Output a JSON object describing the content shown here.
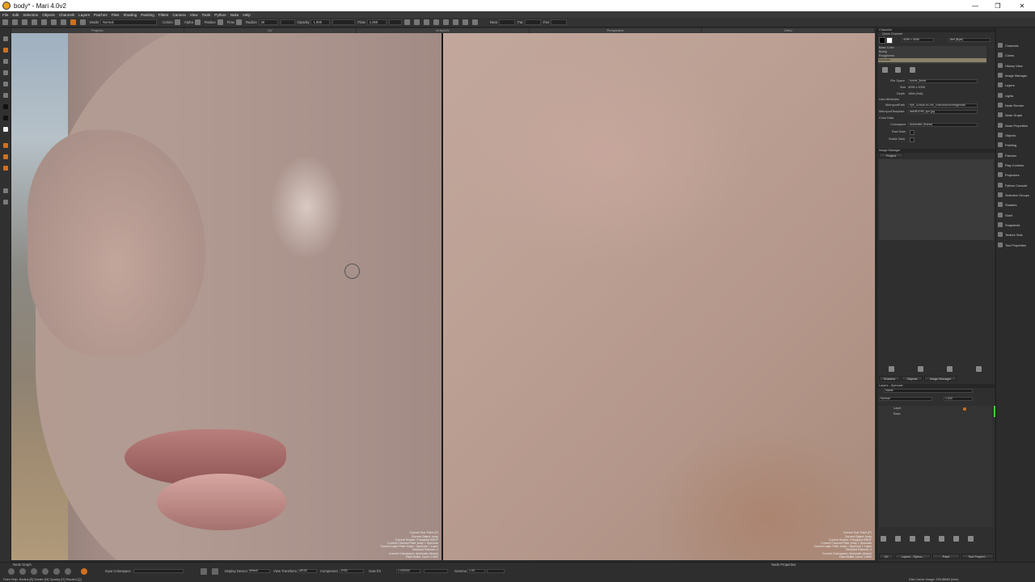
{
  "window": {
    "title": "body* - Mari 4.0v2",
    "minimize": "—",
    "maximize": "❐",
    "close": "✕"
  },
  "menu": [
    "File",
    "Edit",
    "Selection",
    "Objects",
    "Channels",
    "Layers",
    "Patches",
    "Files",
    "Shading",
    "Painting",
    "Filters",
    "Camera",
    "View",
    "Tools",
    "Python",
    "Nuke",
    "Help"
  ],
  "toolbar": {
    "mode_label": "Mode",
    "mode_value": "Normal",
    "colors_label": "Colors",
    "alpha_label": "Alpha",
    "radius_label": "Radius",
    "flow_label": "Flow",
    "radius2_label": "Radius",
    "radius2_value": "30",
    "opacity_label": "Opacity",
    "opacity_value": "1.000",
    "flow2_label": "Flow",
    "flow2_value": "1.000",
    "near_label": "Near",
    "far_label": "Far",
    "fov_label": "Fov"
  },
  "viewport_tabs": [
    "Projects",
    "UV",
    "Ortho/UV",
    "Perspective",
    "Ortho"
  ],
  "hud_left": [
    "Current Tool: Paint (P)",
    "Current Object: body",
    "Current Shader: Principled BRDF",
    "Current Channel Path: body > Specular",
    "Current Layer Path: body > Specular > Layer",
    "Selected Patches: 0",
    "Current Colorspace: Automatic (linear)",
    "Paint Buffer Zoom: 136%"
  ],
  "hud_right": [
    "Current Tool: Paint (P)",
    "Current Object: body",
    "Current Shader: Principled BRDF",
    "Current Channel Path: body > Specular",
    "Current Layer Path: body > Specular > Layer",
    "Selected Patches: 0",
    "Current Colorspace: Automatic (linear)",
    "Paint Buffer Zoom: 136%"
  ],
  "channels": {
    "header": "Channels",
    "quick_label": "Quick Channel",
    "size_value": "4096 x 4096",
    "depth_value": "8bit (Byte)",
    "list": [
      "Base Color",
      "Bump",
      "Roughness",
      "Specular"
    ],
    "file_space_label": "File Space",
    "file_space_value": "scene_linear",
    "size_label": "Size",
    "size_val2": "4096 x 4096",
    "depth_label": "Depth",
    "depth_val2": "16bit (Half)",
    "user_attr": "User Attributes",
    "export_label": "MriImportPath",
    "export_value": "eye_DAMAGE/Jiru_Elan/source/image/skin",
    "template_label": "MriImportTemplate",
    "template_value": "skin$UDIM_spc.jpg",
    "color_data": "Color Data",
    "colorspace_label": "Colorspace",
    "colorspace_value": "Automatic (linear)",
    "raw_label": "Raw Data",
    "scalar_label": "Scalar Data"
  },
  "image_manager": {
    "header": "Image Manager",
    "project_tab": "Project"
  },
  "mid_tabs": [
    "Shaders",
    "Objects",
    "Image Manager"
  ],
  "layers": {
    "header": "Layers - Specular",
    "search_placeholder": "Name",
    "blend_value": "Normal",
    "opacity_value": "1.000",
    "items": [
      "Layer",
      "Base"
    ]
  },
  "bottom_tabs": [
    "Ch",
    "Layers - Specu...",
    "Paint",
    "Tool Propert..."
  ],
  "right_strip": [
    "Channels",
    "Colors",
    "History View",
    "Image Manager",
    "Layers",
    "Lights",
    "Node Render",
    "Node Graph",
    "Node Properties",
    "Objects",
    "Painting",
    "Patches",
    "Play Controls",
    "Projectors",
    "Python Console",
    "Selection Groups",
    "Shaders",
    "Shelf",
    "Snapshots",
    "Texture Sets",
    "Tool Properties"
  ],
  "bottom": {
    "node_graph": "Node Graph",
    "node_props": "Node Properties",
    "input_cs_label": "Input Colorspace",
    "display_label": "Display Device",
    "display_value": "default",
    "view_label": "View Transform",
    "view_value": "sRGB",
    "component_label": "Component",
    "component_value": "RGB",
    "gain_label": "Gain f/S",
    "gain_value": "1.000000",
    "gamma_label": "Gamma",
    "gamma_value": "1.00",
    "status": "Paint Help:   Radius [R]   Rotate [W]   Opacity [O]   Repaint [Q]",
    "disk": "Disk Cache Usage: 299.88MB (ulim)"
  }
}
